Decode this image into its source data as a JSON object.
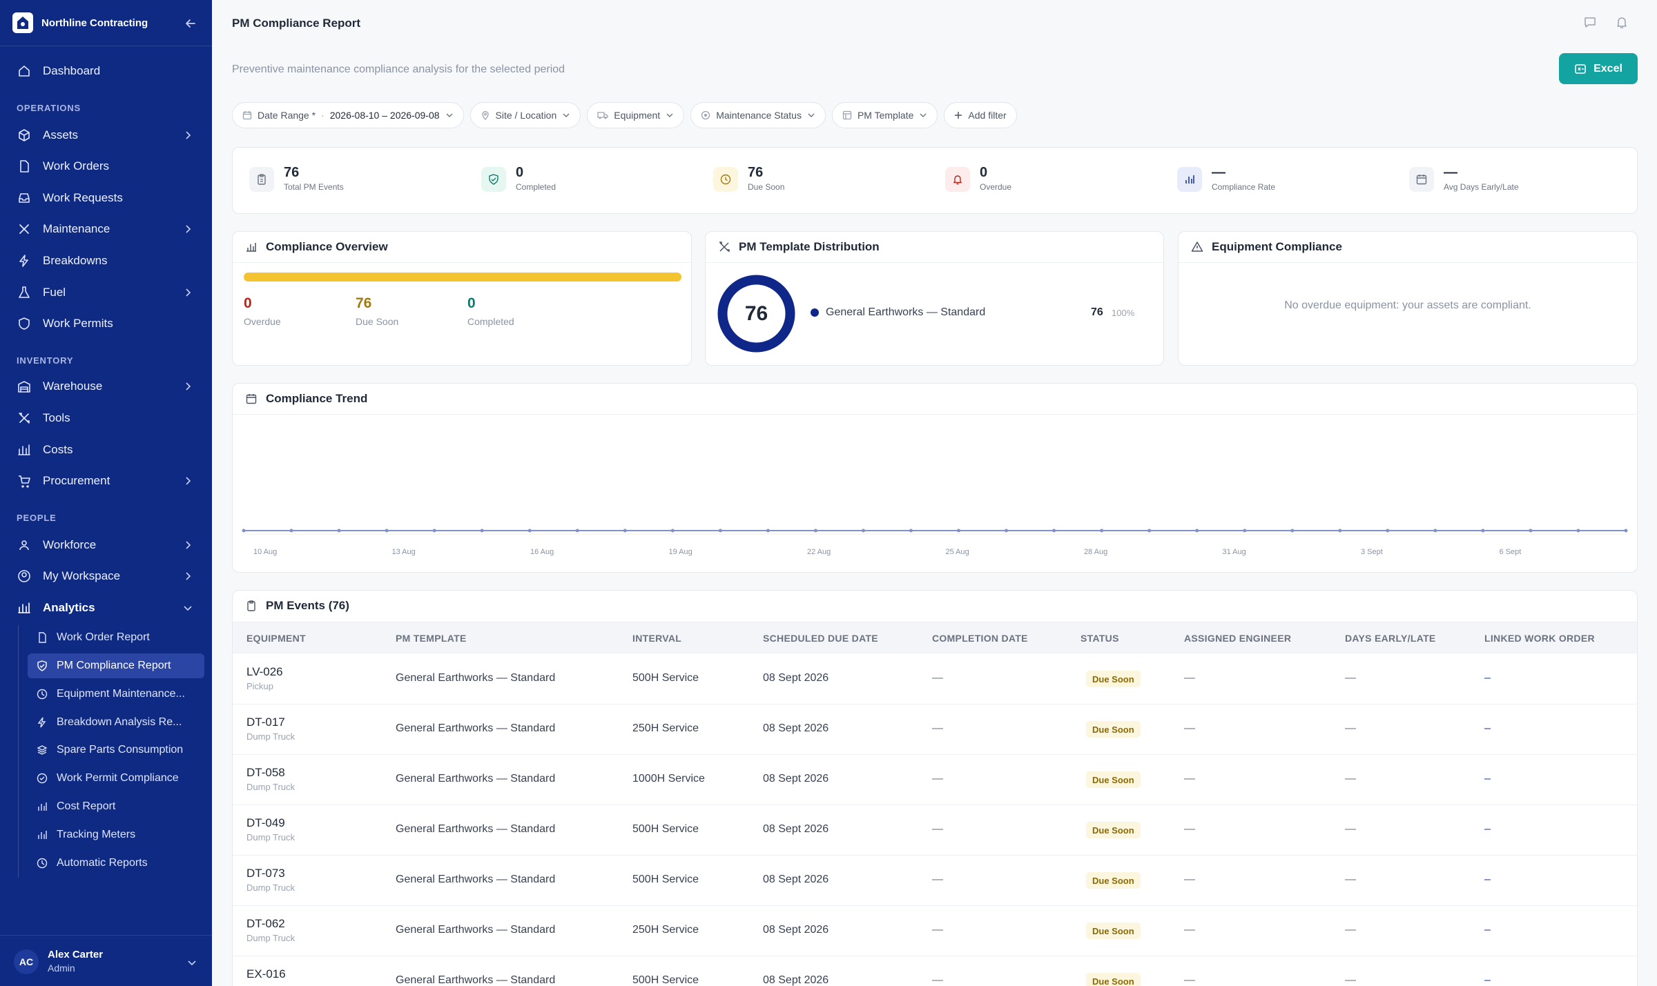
{
  "brand": {
    "name": "Northline Contracting"
  },
  "nav": {
    "dashboard": "Dashboard",
    "sections": {
      "operations": "OPERATIONS",
      "inventory": "INVENTORY",
      "people": "PEOPLE"
    },
    "items": {
      "assets": "Assets",
      "work_orders": "Work Orders",
      "work_requests": "Work Requests",
      "maintenance": "Maintenance",
      "breakdowns": "Breakdowns",
      "fuel": "Fuel",
      "work_permits": "Work Permits",
      "warehouse": "Warehouse",
      "tools": "Tools",
      "costs": "Costs",
      "procurement": "Procurement",
      "workforce": "Workforce",
      "my_workspace": "My Workspace",
      "analytics": "Analytics"
    },
    "analytics_sub": [
      "Work Order Report",
      "PM Compliance Report",
      "Equipment Maintenance...",
      "Breakdown Analysis Re...",
      "Spare Parts Consumption",
      "Work Permit Compliance",
      "Cost Report",
      "Tracking Meters",
      "Automatic Reports"
    ]
  },
  "user": {
    "initials": "AC",
    "name": "Alex Carter",
    "role": "Admin"
  },
  "header": {
    "title": "PM Compliance Report",
    "subtitle": "Preventive maintenance compliance analysis for the selected period",
    "export_label": "Excel"
  },
  "filters": {
    "date_range_label": "Date Range *",
    "date_range_value": "2026-08-10 – 2026-09-08",
    "site": "Site / Location",
    "equipment": "Equipment",
    "status": "Maintenance Status",
    "template": "PM Template",
    "add": "Add filter"
  },
  "stats": [
    {
      "value": "76",
      "label": "Total PM Events",
      "icon": "clipboard-icon"
    },
    {
      "value": "0",
      "label": "Completed",
      "icon": "shield-check-icon"
    },
    {
      "value": "76",
      "label": "Due Soon",
      "icon": "clock-icon"
    },
    {
      "value": "0",
      "label": "Overdue",
      "icon": "bell-icon"
    },
    {
      "value": "—",
      "label": "Compliance Rate",
      "icon": "bar-chart-icon"
    },
    {
      "value": "—",
      "label": "Avg Days Early/Late",
      "icon": "calendar-icon"
    }
  ],
  "overview": {
    "title": "Compliance Overview",
    "overdue": {
      "value": "0",
      "label": "Overdue"
    },
    "due_soon": {
      "value": "76",
      "label": "Due Soon"
    },
    "completed": {
      "value": "0",
      "label": "Completed"
    },
    "due_soon_fraction": 1.0
  },
  "distribution": {
    "title": "PM Template Distribution",
    "total": "76",
    "items": [
      {
        "name": "General Earthworks — Standard",
        "count": "76",
        "pct": "100%"
      }
    ]
  },
  "equipment_compliance": {
    "title": "Equipment Compliance",
    "empty": "No overdue equipment: your assets are compliant."
  },
  "trend": {
    "title": "Compliance Trend",
    "x_ticks": [
      "10 Aug",
      "13 Aug",
      "16 Aug",
      "19 Aug",
      "22 Aug",
      "25 Aug",
      "28 Aug",
      "31 Aug",
      "3 Sept",
      "6 Sept"
    ],
    "points": 30,
    "value": 0
  },
  "events": {
    "title": "PM Events (76)",
    "columns": [
      "EQUIPMENT",
      "PM TEMPLATE",
      "INTERVAL",
      "SCHEDULED DUE DATE",
      "COMPLETION DATE",
      "STATUS",
      "ASSIGNED ENGINEER",
      "DAYS EARLY/LATE",
      "LINKED WORK ORDER"
    ],
    "rows": [
      {
        "id": "LV-026",
        "type": "Pickup",
        "template": "General Earthworks — Standard",
        "interval": "500H Service",
        "due": "08 Sept 2026",
        "completion": "—",
        "status": "Due Soon",
        "engineer": "—",
        "days": "—",
        "wo": "–"
      },
      {
        "id": "DT-017",
        "type": "Dump Truck",
        "template": "General Earthworks — Standard",
        "interval": "250H Service",
        "due": "08 Sept 2026",
        "completion": "—",
        "status": "Due Soon",
        "engineer": "—",
        "days": "—",
        "wo": "–"
      },
      {
        "id": "DT-058",
        "type": "Dump Truck",
        "template": "General Earthworks — Standard",
        "interval": "1000H Service",
        "due": "08 Sept 2026",
        "completion": "—",
        "status": "Due Soon",
        "engineer": "—",
        "days": "—",
        "wo": "–"
      },
      {
        "id": "DT-049",
        "type": "Dump Truck",
        "template": "General Earthworks — Standard",
        "interval": "500H Service",
        "due": "08 Sept 2026",
        "completion": "—",
        "status": "Due Soon",
        "engineer": "—",
        "days": "—",
        "wo": "–"
      },
      {
        "id": "DT-073",
        "type": "Dump Truck",
        "template": "General Earthworks — Standard",
        "interval": "500H Service",
        "due": "08 Sept 2026",
        "completion": "—",
        "status": "Due Soon",
        "engineer": "—",
        "days": "—",
        "wo": "–"
      },
      {
        "id": "DT-062",
        "type": "Dump Truck",
        "template": "General Earthworks — Standard",
        "interval": "250H Service",
        "due": "08 Sept 2026",
        "completion": "—",
        "status": "Due Soon",
        "engineer": "—",
        "days": "—",
        "wo": "–"
      },
      {
        "id": "EX-016",
        "type": "",
        "template": "General Earthworks — Standard",
        "interval": "500H Service",
        "due": "08 Sept 2026",
        "completion": "—",
        "status": "Due Soon",
        "engineer": "—",
        "days": "—",
        "wo": "–"
      }
    ]
  },
  "colors": {
    "sidebar": "#0e2a82",
    "accent": "#13a3a0",
    "overdue": "#b3261e",
    "due_soon": "#a07a10",
    "completed": "#0f7b6c",
    "progress": "#f4c330",
    "donut": "#10278a"
  }
}
